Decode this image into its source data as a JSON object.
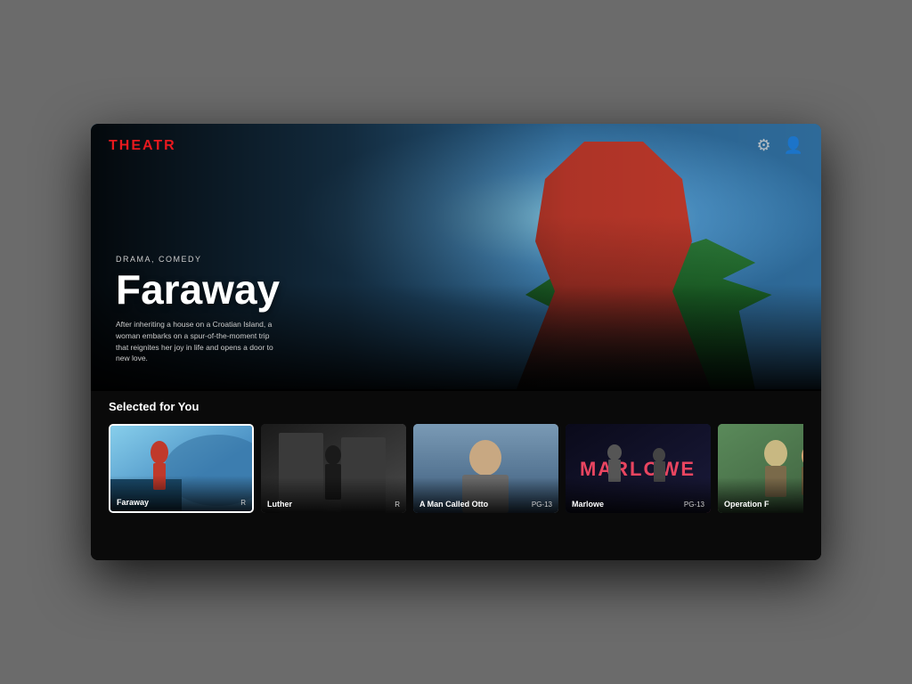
{
  "app": {
    "name": "THEATR",
    "colors": {
      "logo": "#e8191e",
      "background": "#0a0a0a",
      "text_primary": "#ffffff",
      "text_secondary": "#cccccc",
      "accent": "#e8191e"
    }
  },
  "header": {
    "logo": "THEATR",
    "settings_icon": "⚙",
    "profile_icon": "👤"
  },
  "hero": {
    "genre": "DRAMA, COMEDY",
    "title": "Faraway",
    "description": "After inheriting a house on a Croatian Island, a woman embarks on a spur-of-the-moment trip that reignites her joy in life and opens a door to new love."
  },
  "selected_section": {
    "title": "Selected for You",
    "cards": [
      {
        "id": "faraway",
        "title": "Faraway",
        "rating": "R",
        "selected": true
      },
      {
        "id": "luther",
        "title": "Luther",
        "rating": "R",
        "selected": false
      },
      {
        "id": "otto",
        "title": "A Man Called Otto",
        "rating": "PG-13",
        "selected": false
      },
      {
        "id": "marlowe",
        "title": "Marlowe",
        "rating": "PG-13",
        "selected": false
      },
      {
        "id": "operation",
        "title": "Operation F",
        "rating": "",
        "selected": false
      }
    ]
  }
}
